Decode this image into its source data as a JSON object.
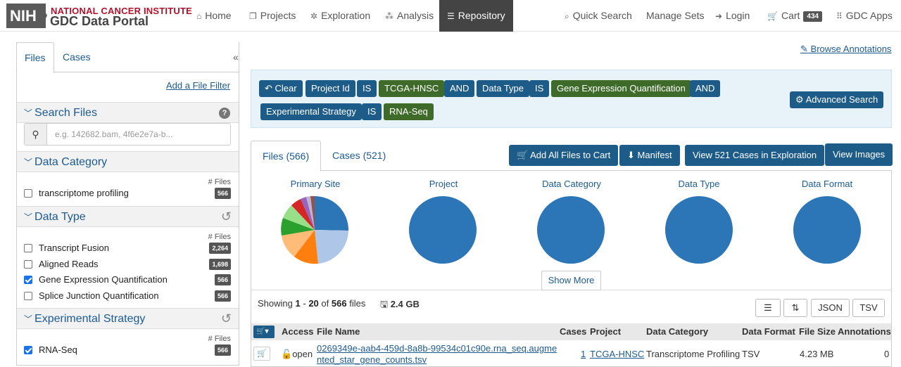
{
  "header": {
    "logo_box": "NIH",
    "logo_line1": "NATIONAL CANCER INSTITUTE",
    "logo_line2": "GDC Data Portal",
    "nav": [
      {
        "label": "Home",
        "icon": "home-icon"
      },
      {
        "label": "Projects",
        "icon": "projects-icon"
      },
      {
        "label": "Exploration",
        "icon": "exploration-icon"
      },
      {
        "label": "Analysis",
        "icon": "analysis-icon"
      },
      {
        "label": "Repository",
        "icon": "database-icon"
      }
    ],
    "right": {
      "quick_search": "Quick Search",
      "manage_sets": "Manage Sets",
      "login": "Login",
      "cart": "Cart",
      "cart_count": "434",
      "gdc_apps": "GDC Apps"
    }
  },
  "sidebar": {
    "tabs": [
      "Files",
      "Cases"
    ],
    "collapse": "«",
    "add_filter": "Add a File Filter",
    "search": {
      "title": "Search Files",
      "placeholder": "e.g. 142682.bam, 4f6e2e7a-b..."
    },
    "files_count_label": "# Files",
    "facets": [
      {
        "title": "Data Category",
        "items": [
          {
            "label": "transcriptome profiling",
            "count": "566",
            "checked": false
          }
        ]
      },
      {
        "title": "Data Type",
        "items": [
          {
            "label": "Transcript Fusion",
            "count": "2,264",
            "checked": false
          },
          {
            "label": "Aligned Reads",
            "count": "1,698",
            "checked": false
          },
          {
            "label": "Gene Expression Quantification",
            "count": "566",
            "checked": true
          },
          {
            "label": "Splice Junction Quantification",
            "count": "566",
            "checked": false
          }
        ]
      },
      {
        "title": "Experimental Strategy",
        "items": [
          {
            "label": "RNA-Seq",
            "count": "566",
            "checked": true
          }
        ]
      }
    ]
  },
  "main": {
    "browse_annotations": "Browse Annotations",
    "query": {
      "clear": "Clear",
      "pills": [
        "Project Id",
        "IS",
        "TCGA-HNSC",
        "AND",
        "Data Type",
        "IS",
        "Gene Expression Quantification",
        "AND",
        "Experimental Strategy",
        "IS",
        "RNA-Seq"
      ],
      "advanced": "Advanced Search"
    },
    "tabs": [
      "Files (566)",
      "Cases (521)"
    ],
    "actions": {
      "add_all": "Add All Files to Cart",
      "manifest": "Manifest",
      "view_cases": "View 521 Cases in Exploration",
      "view_images": "View Images"
    },
    "charts": [
      "Primary Site",
      "Project",
      "Data Category",
      "Data Type",
      "Data Format"
    ],
    "show_more": "Show More",
    "summary": {
      "showing": "Showing",
      "from": "1",
      "dash": "-",
      "to": "20",
      "of": "of",
      "total": "566",
      "unit": "files",
      "size": "2.4 GB"
    },
    "table_buttons": {
      "json": "JSON",
      "tsv": "TSV"
    },
    "columns": [
      "Access",
      "File Name",
      "Cases",
      "Project",
      "Data Category",
      "Data Format",
      "File Size",
      "Annotations"
    ],
    "rows": [
      {
        "access": "open",
        "file_name_1": "0269349e-aab4-459d-8a8b-99534c01c90e.rna_seq.augme",
        "file_name_2": "nted_star_gene_counts.tsv",
        "cases": "1",
        "project": "TCGA-HNSC",
        "data_category": "Transcriptome Profiling",
        "data_format": "TSV",
        "file_size": "4.23 MB",
        "annotations": "0"
      }
    ]
  },
  "colors": {
    "brand_red": "#b3122b",
    "primary_blue": "#1d5b88",
    "green": "#3e6b2a",
    "pie_blue": "#2c75b6"
  }
}
